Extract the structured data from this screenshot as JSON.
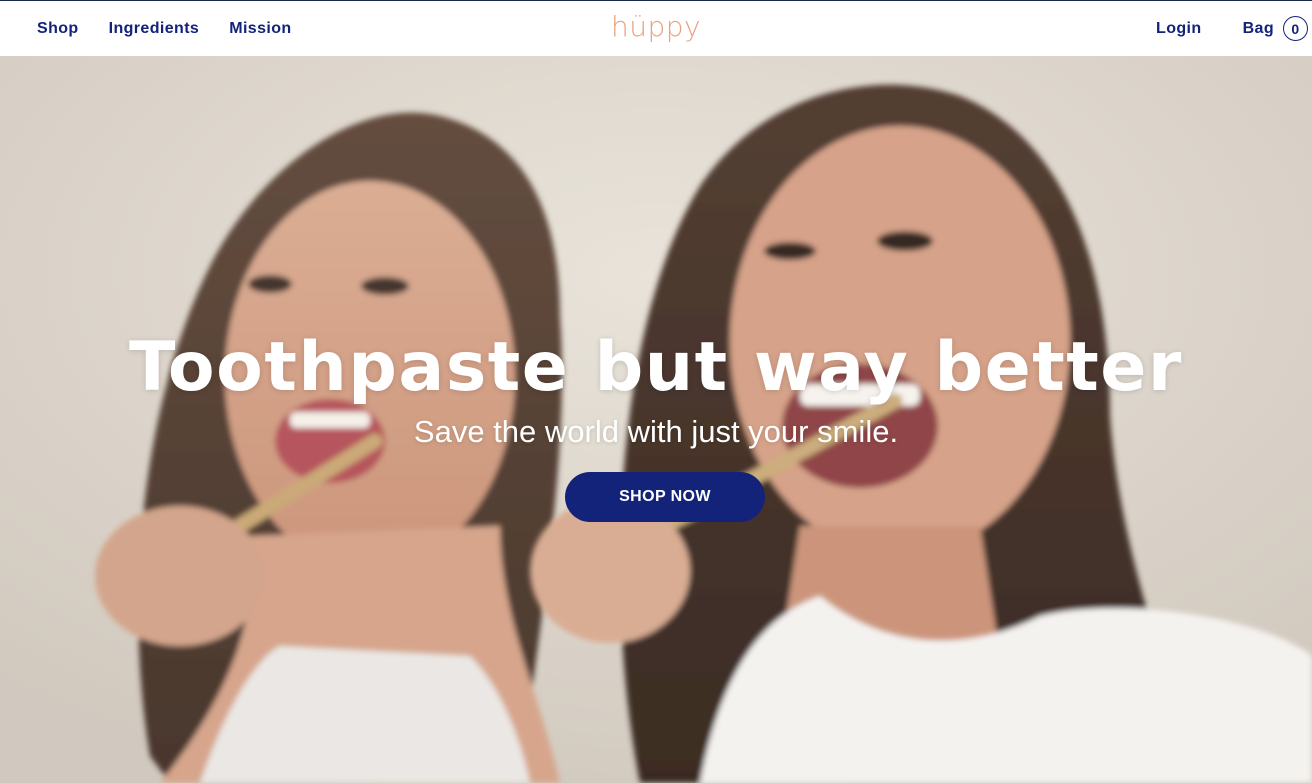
{
  "header": {
    "nav": [
      {
        "label": "Shop"
      },
      {
        "label": "Ingredients"
      },
      {
        "label": "Mission"
      }
    ],
    "logo_text": "hüppy",
    "login_label": "Login",
    "bag_label": "Bag",
    "bag_count": "0"
  },
  "hero": {
    "headline": "Toothpaste but way better",
    "subheadline": "Save the world with just your smile.",
    "cta_label": "SHOP NOW",
    "image_description_icon": "hero-photo"
  },
  "colors": {
    "brand_navy": "#13237a",
    "logo_peach": "#e9a07b",
    "text_white": "#ffffff"
  }
}
